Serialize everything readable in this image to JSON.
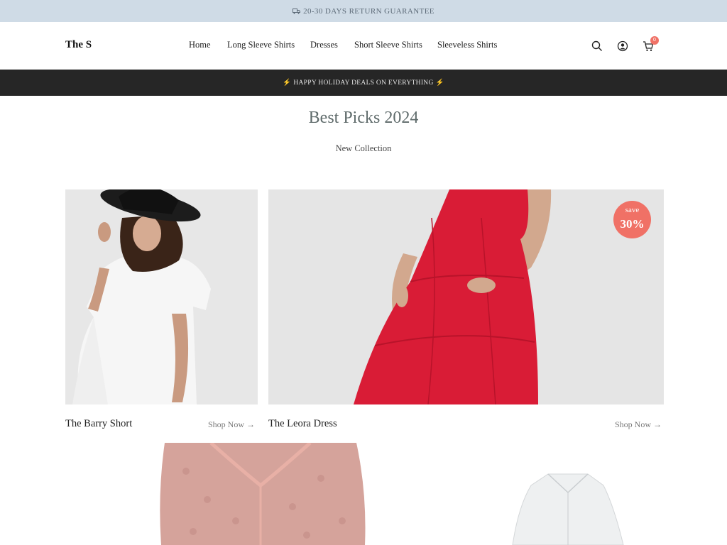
{
  "announcement": {
    "text": "20-30 DAYS RETURN GUARANTEE"
  },
  "header": {
    "logo": "The S",
    "nav": [
      "Home",
      "Long Sleeve Shirts",
      "Dresses",
      "Short Sleeve Shirts",
      "Sleeveless Shirts"
    ],
    "icons": [
      "search-icon",
      "account-icon",
      "cart-icon"
    ],
    "cart_count": "0"
  },
  "promo": {
    "text": "HAPPY HOLIDAY DEALS ON EVERYTHING"
  },
  "section": {
    "title": "Best Picks 2024",
    "subtitle": "New Collection"
  },
  "products": [
    {
      "title": "The Barry Short",
      "link": "Shop Now"
    },
    {
      "title": "The Leora Dress",
      "link": "Shop Now",
      "badge_top": "save",
      "badge_value": "30%"
    }
  ],
  "colors": {
    "accent": "#f07166",
    "topbar": "#cfdbe6",
    "promo_bar": "#262626"
  }
}
